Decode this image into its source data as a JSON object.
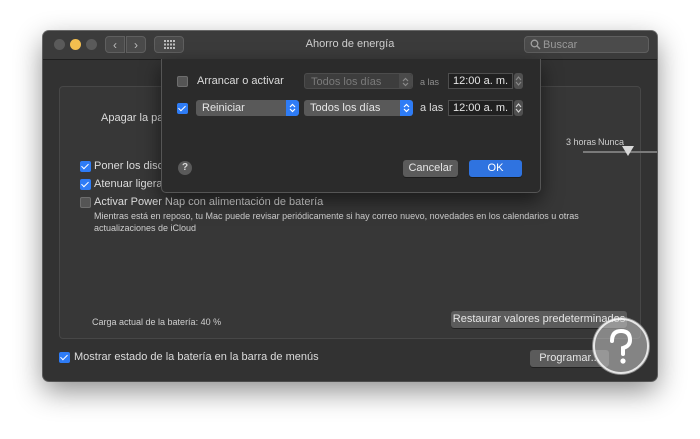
{
  "window": {
    "title": "Ahorro de energía"
  },
  "toolbar": {
    "search_placeholder": "Buscar"
  },
  "settings": {
    "turn_off_label": "Apagar la pa",
    "slider_label_hours": "3 horas",
    "slider_label_never": "Nunca",
    "disks_label": "Poner los disc",
    "dim_label": "Atenuar ligera",
    "power_nap_label": "Activar Power Nap con alimentación de batería",
    "power_nap_desc_1": "Mientras está en reposo, tu Mac puede revisar periódicamente si hay correo nuevo, novedades en los calendarios u otras",
    "power_nap_desc_2": "actualizaciones de iCloud",
    "battery_charge": "Carga actual de la batería: 40 %",
    "restore_button": "Restaurar valores predeterminados",
    "show_battery_label": "Mostrar estado de la batería en la barra de menús",
    "schedule_button": "Programar..."
  },
  "schedule_sheet": {
    "row1": {
      "label": "Arrancar o activar",
      "days": "Todos los días",
      "at": "a las",
      "time": "12:00 a. m.",
      "checked": false
    },
    "row2": {
      "action": "Reiniciar",
      "days": "Todos los días",
      "at": "a las",
      "time": "12:00 a. m.",
      "checked": true
    },
    "help": "?",
    "cancel": "Cancelar",
    "ok": "OK"
  },
  "colors": {
    "accent": "#2e7cf6",
    "window_bg": "#323232",
    "sheet_bg": "#2b2b2b"
  }
}
